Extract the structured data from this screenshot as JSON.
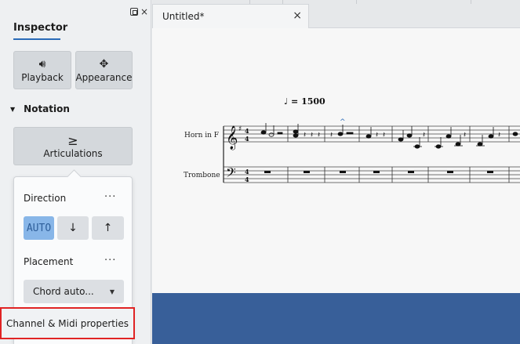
{
  "inspector": {
    "title": "Inspector",
    "playback_label": "Playback",
    "appearance_label": "Appearance",
    "section_notation": "Notation",
    "articulations_label": "Articulations",
    "articulations_glyph": "≥"
  },
  "popup": {
    "direction_label": "Direction",
    "more_glyph": "···",
    "direction_options": {
      "auto": "AUTO",
      "down": "↓",
      "up": "↑"
    },
    "placement_label": "Placement",
    "placement_value": "Chord auto...",
    "channel_button_label": "Channel & Midi properties"
  },
  "tab": {
    "title": "Untitled*",
    "close_glyph": "×"
  },
  "score": {
    "tempo_text": "= 1500",
    "tempo_glyph": "♩",
    "instruments": [
      "Horn in F",
      "Trombone"
    ]
  },
  "colors": {
    "accent": "#2a6bb8",
    "active_button": "#88b6e8",
    "highlight_border": "#e02323",
    "bottom_band": "#385f99"
  }
}
